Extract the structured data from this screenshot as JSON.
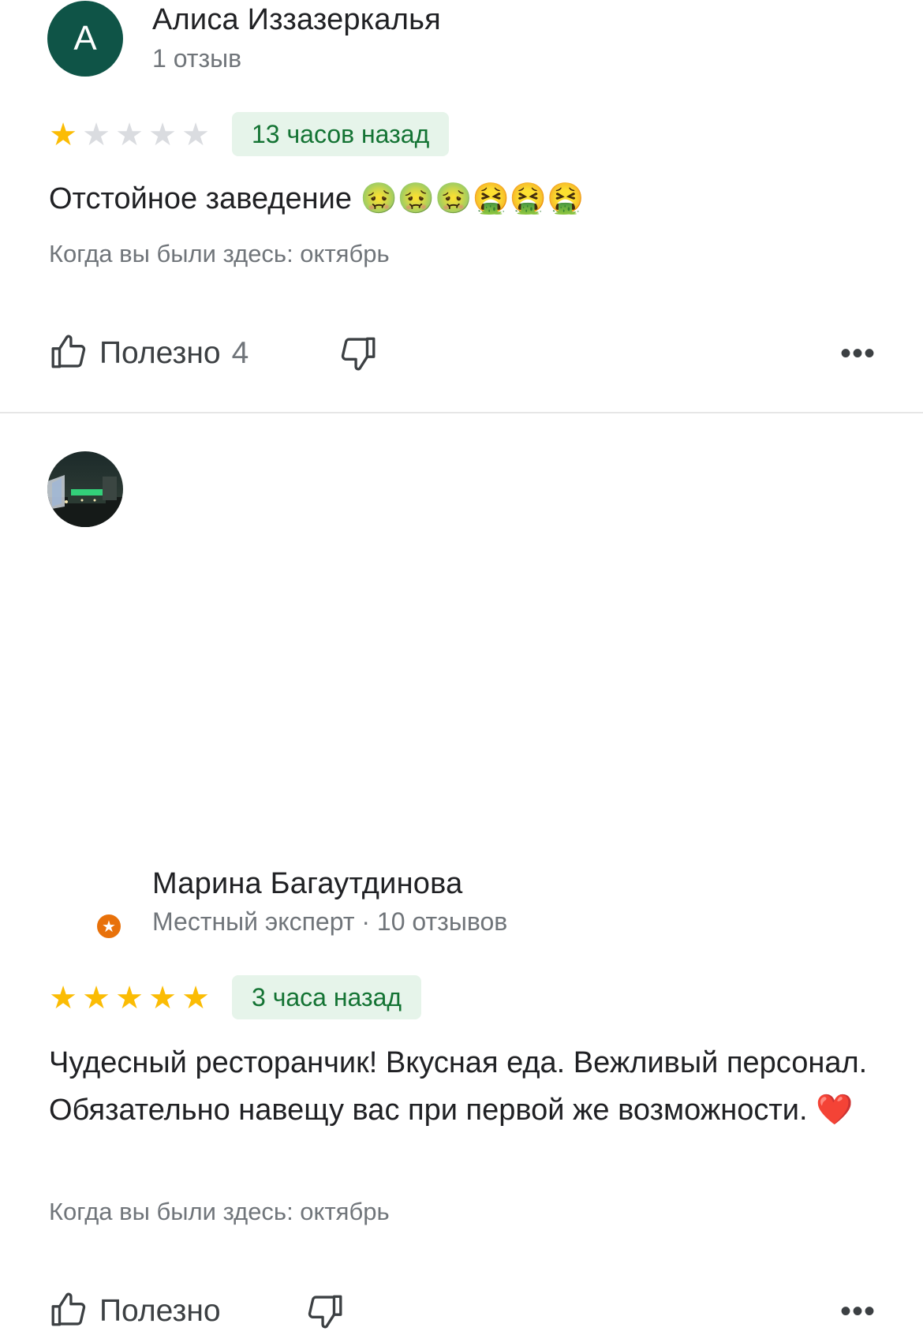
{
  "reviews": [
    {
      "avatar_letter": "А",
      "author": "Алиса Иззазеркалья",
      "meta": "1 отзыв",
      "rating": 1,
      "time": "13 часов назад",
      "text": "Отстойное заведение 🤢🤢🤢🤮🤮🤮",
      "visited": "Когда вы были здесь: октябрь",
      "helpful_label": "Полезно",
      "helpful_count": "4"
    },
    {
      "author": "Марина Багаутдинова",
      "meta": "Местный эксперт · 10 отзывов",
      "rating": 5,
      "time": "3 часа назад",
      "text": "Чудесный ресторанчик! Вкусная еда. Вежливый персонал. Обязательно навещу вас при первой же возможности. ❤️",
      "visited": "Когда вы были здесь: октябрь",
      "helpful_label": "Полезно",
      "helpful_count": ""
    }
  ],
  "icons": {
    "like": "thumbs-up-icon",
    "dislike": "thumbs-down-icon",
    "more": "more-icon",
    "star": "star-icon",
    "badge": "local-guide-star-icon"
  },
  "colors": {
    "star_on": "#fbbc04",
    "star_off": "#dadce0",
    "time_badge_bg": "#e6f4ea",
    "time_badge_text": "#137333",
    "avatar_bg": "#0f5447",
    "guide_badge": "#e8710a"
  }
}
